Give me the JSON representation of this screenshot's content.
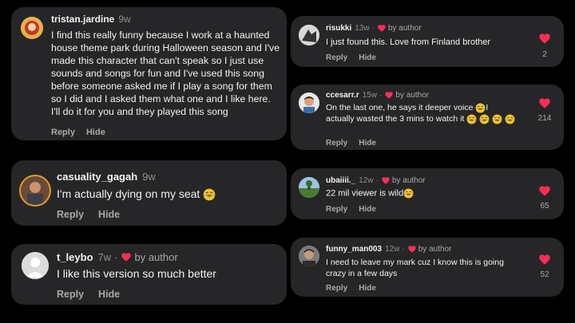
{
  "colors": {
    "background": "#000000",
    "card": "#262628",
    "heart": "#ff2d55",
    "muted": "#8e8e8e"
  },
  "icons": {
    "heart": "heart-icon",
    "laugh_cry": "laughing-crying-emoji"
  },
  "comments_left": [
    {
      "username": "tristan.jardine",
      "time": "9w",
      "text": "I find this really funny because I work at a haunted house theme park during Halloween season and I've made this character that can't speak so I just use sounds and songs for fun and I've used this song before someone asked me if I play a song for them so I did and I asked them what one and I like here. I'll do it for you and they played this song",
      "reply": "Reply",
      "hide": "Hide"
    },
    {
      "username": "casuality_gagah",
      "time": "9w",
      "text": "I'm actually dying on my seat",
      "reply": "Reply",
      "hide": "Hide"
    },
    {
      "username": "t_leybo",
      "time": "7w",
      "separator": "·",
      "author_label": "by author",
      "text": "I like this version so much better",
      "reply": "Reply",
      "hide": "Hide"
    }
  ],
  "comments_right": [
    {
      "username": "risukki",
      "time": "13w",
      "separator": "·",
      "author_label": "by author",
      "text": "I just found this. Love from Finland brother",
      "reply": "Reply",
      "hide": "Hide",
      "likes": "2"
    },
    {
      "username": "ccesarr.r",
      "time": "15w",
      "separator": "·",
      "author_label": "by author",
      "text_a": "On the last one, he says it deeper voice",
      "text_b": "I actually wasted the 3 mins to watch it",
      "reply": "Reply",
      "hide": "Hide",
      "likes": "214"
    },
    {
      "username": "ubaiiii._",
      "time": "12w",
      "separator": "·",
      "author_label": "by author",
      "text": "22 mil viewer is wild",
      "reply": "Reply",
      "hide": "Hide",
      "likes": "65"
    },
    {
      "username": "funny_man003",
      "time": "12w",
      "separator": "·",
      "author_label": "by author",
      "text": "I need to leave my mark cuz I know this is going crazy in a few days",
      "reply": "Reply",
      "hide": "Hide",
      "likes": "52"
    }
  ]
}
